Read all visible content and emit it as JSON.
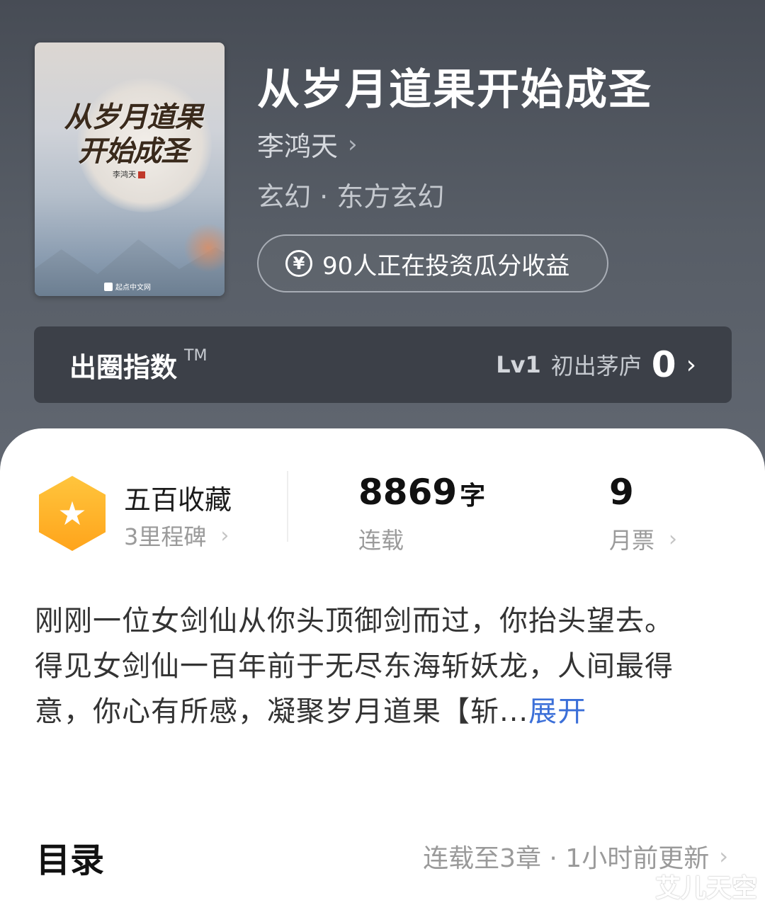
{
  "cover": {
    "title_line1": "从岁月道果",
    "title_line2": "开始成圣",
    "author": "李鸿天",
    "publisher": "起点中文网"
  },
  "book": {
    "title": "从岁月道果开始成圣",
    "author": "李鸿天",
    "genre": "玄幻 · 东方玄幻",
    "invest_text": "90人正在投资瓜分收益",
    "invest_icon": "yen-icon"
  },
  "index_bar": {
    "label": "出圈指数",
    "tm": "TM",
    "level": "Lv1",
    "level_name": "初出茅庐",
    "score": "0"
  },
  "stats": {
    "collection_title": "五百收藏",
    "collection_sub": "3里程碑",
    "word_count": "8869",
    "word_unit": "字",
    "status": "连载",
    "monthly_votes": "9",
    "monthly_votes_label": "月票"
  },
  "synopsis": {
    "line1": "刚刚一位女剑仙从你头顶御剑而过，你抬头望去。",
    "line2_visible": "得见女剑仙一百年前于无尽东海斩妖龙，人间最得意，你心有所感，凝聚岁月道果【斩...",
    "expand_label": "展开",
    "link_color": "#3b6fd8"
  },
  "toc": {
    "title": "目录",
    "status": "连载至3章 · 1小时前更新"
  },
  "watermark": "艾儿天空",
  "colors": {
    "header_bg": "#575d66",
    "badge": "#ffb02e"
  }
}
